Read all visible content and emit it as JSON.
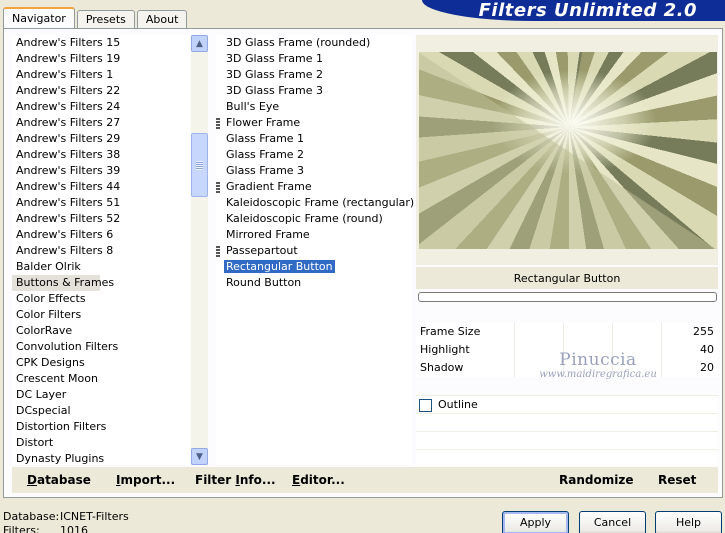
{
  "app": {
    "brand_title": "Filters Unlimited 2.0"
  },
  "tabs": [
    {
      "label": "Navigator",
      "active": true
    },
    {
      "label": "Presets",
      "active": false
    },
    {
      "label": "About",
      "active": false
    }
  ],
  "categories": {
    "items": [
      "Andrew's Filters 15",
      "Andrew's Filters 19",
      "Andrew's Filters 1",
      "Andrew's Filters 22",
      "Andrew's Filters 24",
      "Andrew's Filters 27",
      "Andrew's Filters 29",
      "Andrew's Filters 38",
      "Andrew's Filters 39",
      "Andrew's Filters 44",
      "Andrew's Filters 51",
      "Andrew's Filters 52",
      "Andrew's Filters 6",
      "Andrew's Filters 8",
      "Balder Olrik",
      "Buttons & Frames",
      "Color Effects",
      "Color Filters",
      "ColorRave",
      "Convolution Filters",
      "CPK Designs",
      "Crescent Moon",
      "DC Layer",
      "DCspecial",
      "Distortion Filters",
      "Distort",
      "Dynasty Plugins"
    ],
    "selected": "Buttons & Frames",
    "scroll_up_icon": "chevron-up-icon",
    "scroll_down_icon": "chevron-down-icon"
  },
  "filters": {
    "items": [
      {
        "label": "3D Glass Frame (rounded)",
        "marked": false
      },
      {
        "label": "3D Glass Frame 1",
        "marked": false
      },
      {
        "label": "3D Glass Frame 2",
        "marked": false
      },
      {
        "label": "3D Glass Frame 3",
        "marked": false
      },
      {
        "label": "Bull's Eye",
        "marked": false
      },
      {
        "label": "Flower Frame",
        "marked": true
      },
      {
        "label": "Glass Frame 1",
        "marked": false
      },
      {
        "label": "Glass Frame 2",
        "marked": false
      },
      {
        "label": "Glass Frame 3",
        "marked": false
      },
      {
        "label": "Gradient Frame",
        "marked": true
      },
      {
        "label": "Kaleidoscopic Frame (rectangular)",
        "marked": false
      },
      {
        "label": "Kaleidoscopic Frame (round)",
        "marked": false
      },
      {
        "label": "Mirrored Frame",
        "marked": false
      },
      {
        "label": "Passepartout",
        "marked": true
      },
      {
        "label": "Rectangular Button",
        "marked": false
      },
      {
        "label": "Round Button",
        "marked": false
      }
    ],
    "selected": "Rectangular Button"
  },
  "preview": {
    "filter_title": "Rectangular Button"
  },
  "parameters": [
    {
      "name": "Frame Size",
      "value": "255"
    },
    {
      "name": "Highlight",
      "value": "40"
    },
    {
      "name": "Shadow",
      "value": "20"
    }
  ],
  "watermark": {
    "name": "Pinuccia",
    "site": "www.maidiregrafica.eu"
  },
  "options": {
    "outline_label": "Outline",
    "outline_checked": false
  },
  "bottom_buttons": {
    "database_pre": "",
    "database_key": "D",
    "database_post": "atabase",
    "import_pre": "",
    "import_key": "I",
    "import_post": "mport...",
    "filter_info_pre": "Filter ",
    "filter_info_key": "I",
    "filter_info_post": "nfo...",
    "editor_pre": "",
    "editor_key": "E",
    "editor_post": "ditor...",
    "randomize": "Randomize",
    "reset": "Reset"
  },
  "status": {
    "database_label": "Database:",
    "database_value": "ICNET-Filters",
    "filters_label": "Filters:",
    "filters_value": "1016"
  },
  "dialog_buttons": {
    "apply": "Apply",
    "cancel": "Cancel",
    "help": "Help"
  }
}
